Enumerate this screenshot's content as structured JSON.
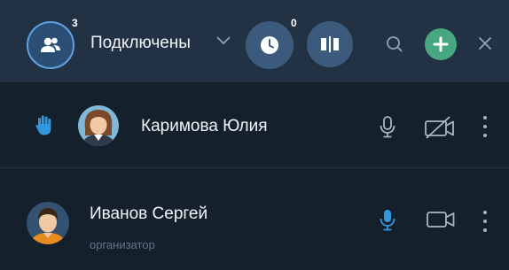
{
  "header": {
    "participants_count": "3",
    "dropdown_label": "Подключены",
    "queue_count": "0"
  },
  "participants": [
    {
      "name": "Каримова Юлия",
      "role": "",
      "hand_raised": true,
      "mic": "on",
      "camera": "off"
    },
    {
      "name": "Иванов Сергей",
      "role": "организатор",
      "hand_raised": false,
      "mic": "active",
      "camera": "on"
    }
  ],
  "colors": {
    "header_bg": "#223244",
    "body_bg": "#15202d",
    "accent_blue": "#3596e0",
    "add_green": "#47a77f",
    "icon_gray": "#a8b6c4"
  },
  "icons": {
    "participants": "people-icon",
    "dropdown": "chevron-down-icon",
    "queue": "clock-icon",
    "layout": "layout-columns-icon",
    "search": "search-icon",
    "add": "plus-icon",
    "close": "close-icon",
    "hand": "raised-hand-icon",
    "mic": "microphone-icon",
    "camera": "camera-icon",
    "camera_off": "camera-off-icon",
    "more": "more-vertical-icon"
  }
}
